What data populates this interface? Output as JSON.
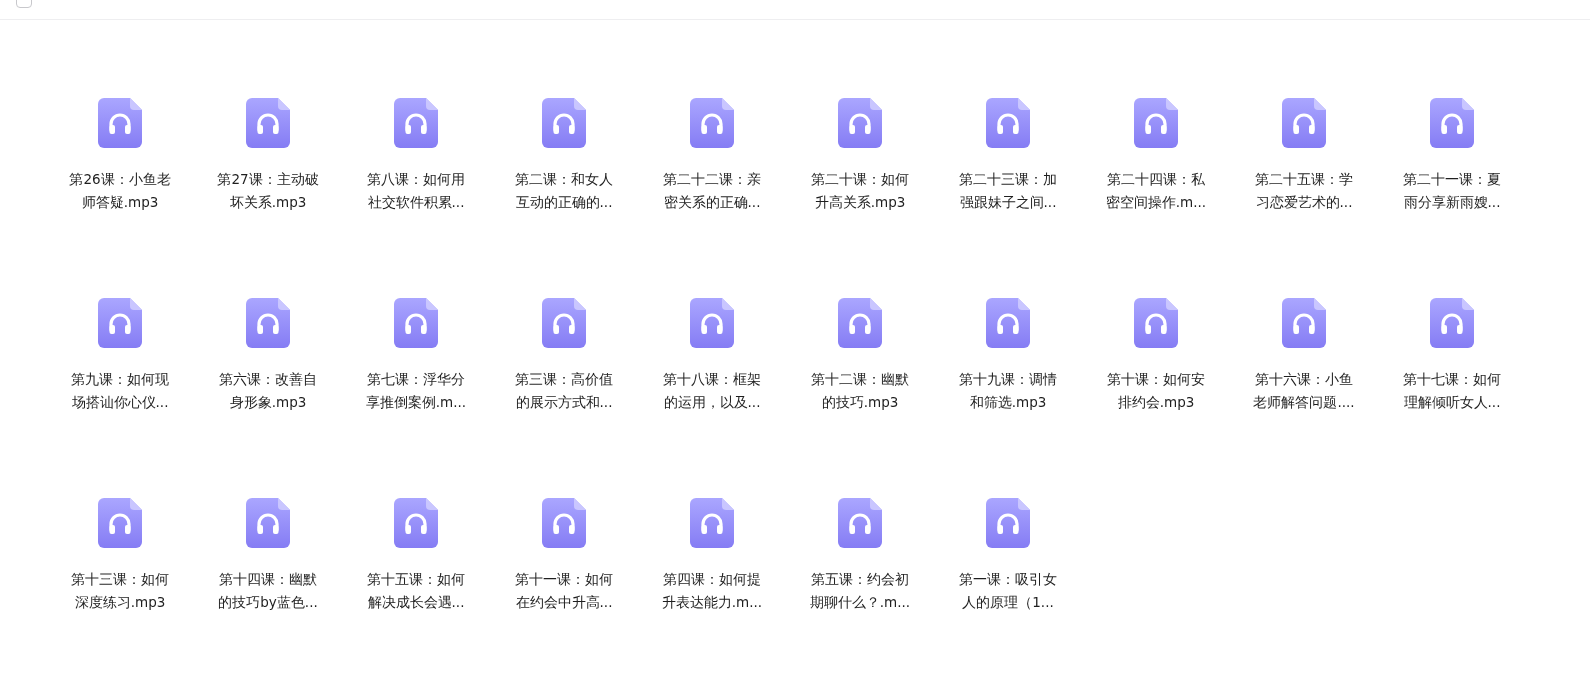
{
  "header": {
    "select_all": {
      "checked": false
    }
  },
  "files": [
    {
      "name_lines": [
        "第26课：小鱼老",
        "师答疑.mp3"
      ]
    },
    {
      "name_lines": [
        "第27课：主动破",
        "坏关系.mp3"
      ]
    },
    {
      "name_lines": [
        "第八课：如何用",
        "社交软件积累..."
      ]
    },
    {
      "name_lines": [
        "第二课：和女人",
        "互动的正确的..."
      ]
    },
    {
      "name_lines": [
        "第二十二课：亲",
        "密关系的正确..."
      ]
    },
    {
      "name_lines": [
        "第二十课：如何",
        "升高关系.mp3"
      ]
    },
    {
      "name_lines": [
        "第二十三课：加",
        "强跟妹子之间..."
      ]
    },
    {
      "name_lines": [
        "第二十四课：私",
        "密空间操作.m..."
      ]
    },
    {
      "name_lines": [
        "第二十五课：学",
        "习恋爱艺术的..."
      ]
    },
    {
      "name_lines": [
        "第二十一课：夏",
        "雨分享新雨嫂..."
      ]
    },
    {
      "name_lines": [
        "第九课：如何现",
        "场搭讪你心仪..."
      ]
    },
    {
      "name_lines": [
        "第六课：改善自",
        "身形象.mp3"
      ]
    },
    {
      "name_lines": [
        "第七课：浮华分",
        "享推倒案例.m..."
      ]
    },
    {
      "name_lines": [
        "第三课：高价值",
        "的展示方式和..."
      ]
    },
    {
      "name_lines": [
        "第十八课：框架",
        "的运用，以及..."
      ]
    },
    {
      "name_lines": [
        "第十二课：幽默",
        "的技巧.mp3"
      ]
    },
    {
      "name_lines": [
        "第十九课：调情",
        "和筛选.mp3"
      ]
    },
    {
      "name_lines": [
        "第十课：如何安",
        "排约会.mp3"
      ]
    },
    {
      "name_lines": [
        "第十六课：小鱼",
        "老师解答问题...."
      ]
    },
    {
      "name_lines": [
        "第十七课：如何",
        "理解倾听女人..."
      ]
    },
    {
      "name_lines": [
        "第十三课：如何",
        "深度练习.mp3"
      ]
    },
    {
      "name_lines": [
        "第十四课：幽默",
        "的技巧by蓝色..."
      ]
    },
    {
      "name_lines": [
        "第十五课：如何",
        "解决成长会遇..."
      ]
    },
    {
      "name_lines": [
        "第十一课：如何",
        "在约会中升高..."
      ]
    },
    {
      "name_lines": [
        "第四课：如何提",
        "升表达能力.m..."
      ]
    },
    {
      "name_lines": [
        "第五课：约会初",
        "期聊什么？.m..."
      ]
    },
    {
      "name_lines": [
        "第一课：吸引女",
        "人的原理（1..."
      ]
    }
  ]
}
